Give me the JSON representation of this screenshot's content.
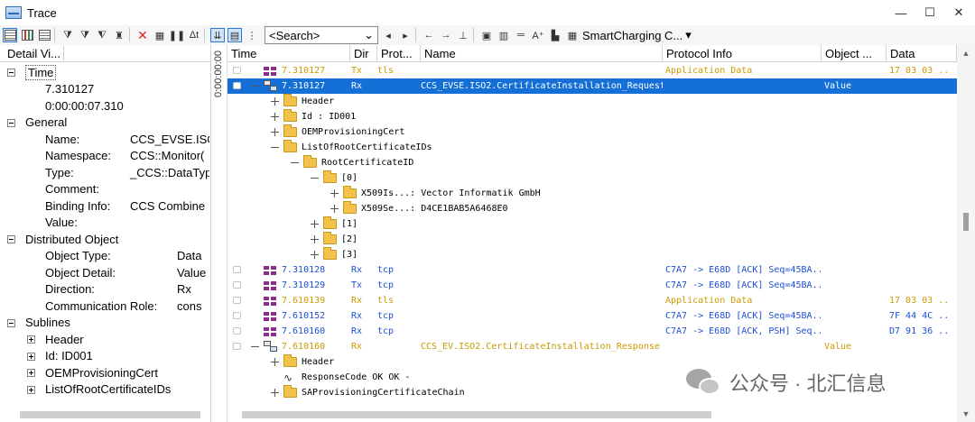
{
  "window": {
    "title": "Trace",
    "controls": {
      "minimize": "—",
      "maximize": "☐",
      "close": "✕"
    }
  },
  "toolbar": {
    "search_placeholder": "<Search>",
    "smartcharging_label": "SmartCharging C...",
    "search_dropdown": "⌄"
  },
  "detail_panel": {
    "header": "Detail Vi...",
    "rows": [
      {
        "type": "group",
        "label": "Time",
        "boxed": true
      },
      {
        "type": "value",
        "label": "7.310127"
      },
      {
        "type": "value",
        "label": "0:00:00:07.310"
      },
      {
        "type": "group",
        "label": "General"
      },
      {
        "type": "field",
        "label": "Name:",
        "value": "CCS_EVSE.ISO"
      },
      {
        "type": "field",
        "label": "Namespace:",
        "value": "CCS::Monitor("
      },
      {
        "type": "field",
        "label": "Type:",
        "value": "_CCS::DataTyp"
      },
      {
        "type": "field",
        "label": "Comment:",
        "value": ""
      },
      {
        "type": "field",
        "label": "Binding Info:",
        "value": "CCS Combine"
      },
      {
        "type": "field",
        "label": "Value:",
        "value": ""
      },
      {
        "type": "group",
        "label": "Distributed Object"
      },
      {
        "type": "field2",
        "label": "Object Type:",
        "value": "Data"
      },
      {
        "type": "field2",
        "label": "Object Detail:",
        "value": "Value"
      },
      {
        "type": "field2",
        "label": "Direction:",
        "value": "Rx"
      },
      {
        "type": "field2",
        "label": "Communication Role:",
        "value": "cons"
      },
      {
        "type": "group",
        "label": "Sublines"
      },
      {
        "type": "sub",
        "label": "Header"
      },
      {
        "type": "sub",
        "label": "Id:     ID001"
      },
      {
        "type": "sub",
        "label": "OEMProvisioningCert"
      },
      {
        "type": "sub",
        "label": "ListOfRootCertificateIDs"
      }
    ]
  },
  "vstrip_text": "0:00:00:00",
  "grid": {
    "columns": [
      "Time",
      "Dir",
      "Prot...",
      "Name",
      "Protocol Info",
      "Object ...",
      "Data"
    ],
    "rows": [
      {
        "kind": "pkt",
        "time": "7.310127",
        "dir": "Tx",
        "prot": "tls",
        "name": "",
        "info": "Application Data",
        "obj": "",
        "data": "17 03 03  ..",
        "tone": "app"
      },
      {
        "kind": "msg",
        "time": "7.310127",
        "dir": "Rx",
        "prot": "",
        "name": "CCS_EVSE.ISO2.CertificateInstallation_Request",
        "info": "",
        "obj": "Value",
        "data": "",
        "selected": true
      },
      {
        "kind": "tree",
        "indent": 0,
        "exp": "plus",
        "icon": "folder",
        "text": "Header"
      },
      {
        "kind": "tree",
        "indent": 0,
        "exp": "plus",
        "icon": "folder",
        "text": "Id        :      ID001"
      },
      {
        "kind": "tree",
        "indent": 0,
        "exp": "plus",
        "icon": "folder",
        "text": "OEMProvisioningCert"
      },
      {
        "kind": "tree",
        "indent": 0,
        "exp": "minus",
        "icon": "folder",
        "text": "ListOfRootCertificateIDs"
      },
      {
        "kind": "tree",
        "indent": 1,
        "exp": "minus",
        "icon": "folder",
        "text": "RootCertificateID"
      },
      {
        "kind": "tree",
        "indent": 2,
        "exp": "minus",
        "icon": "folder",
        "text": "[0]"
      },
      {
        "kind": "tree",
        "indent": 3,
        "exp": "plus",
        "icon": "folder",
        "text": "X509Is...:       Vector Informatik GmbH"
      },
      {
        "kind": "tree",
        "indent": 3,
        "exp": "plus",
        "icon": "folder",
        "text": "X509Se...:       D4CE1BAB5A6468E0"
      },
      {
        "kind": "tree",
        "indent": 2,
        "exp": "plus",
        "icon": "folder",
        "text": "[1]"
      },
      {
        "kind": "tree",
        "indent": 2,
        "exp": "plus",
        "icon": "folder",
        "text": "[2]"
      },
      {
        "kind": "tree",
        "indent": 2,
        "exp": "plus",
        "icon": "folder",
        "text": "[3]"
      },
      {
        "kind": "pkt",
        "time": "7.310128",
        "dir": "Rx",
        "prot": "tcp",
        "name": "",
        "info": "C7A7 -> E68D [ACK] Seq=45BA...",
        "obj": "",
        "data": "",
        "tone": "tcp"
      },
      {
        "kind": "pkt",
        "time": "7.310129",
        "dir": "Tx",
        "prot": "tcp",
        "name": "",
        "info": "C7A7 -> E68D [ACK] Seq=45BA...",
        "obj": "",
        "data": "",
        "tone": "tcp"
      },
      {
        "kind": "pkt",
        "time": "7.610139",
        "dir": "Rx",
        "prot": "tls",
        "name": "",
        "info": "Application Data",
        "obj": "",
        "data": "17 03 03  ..",
        "tone": "app"
      },
      {
        "kind": "pkt",
        "time": "7.610152",
        "dir": "Rx",
        "prot": "tcp",
        "name": "",
        "info": "C7A7 -> E68D [ACK] Seq=45BA...",
        "obj": "",
        "data": "7F 44 4C  ..",
        "tone": "tcp"
      },
      {
        "kind": "pkt",
        "time": "7.610160",
        "dir": "Rx",
        "prot": "tcp",
        "name": "",
        "info": "C7A7 -> E68D [ACK, PSH] Seq...",
        "obj": "",
        "data": "D7 91 36  ..",
        "tone": "tcp"
      },
      {
        "kind": "msg",
        "time": "7.610160",
        "dir": "Rx",
        "prot": "",
        "name": "CCS_EV.ISO2.CertificateInstallation_Response",
        "info": "",
        "obj": "Value",
        "data": "",
        "tone": "app"
      },
      {
        "kind": "tree",
        "indent": 0,
        "exp": "plus",
        "icon": "folder",
        "text": "Header"
      },
      {
        "kind": "tree",
        "indent": 0,
        "exp": "none",
        "icon": "wave",
        "text": "ResponseCode        OK         OK      -"
      },
      {
        "kind": "tree",
        "indent": 0,
        "exp": "plus",
        "icon": "folder",
        "text": "SAProvisioningCertificateChain"
      }
    ]
  },
  "watermark": "公众号 · 北汇信息",
  "colors": {
    "selection": "#1470d6",
    "tls": "#c99a00",
    "tcp": "#1c4fd6",
    "packet_icon": "#8a2e8a"
  }
}
